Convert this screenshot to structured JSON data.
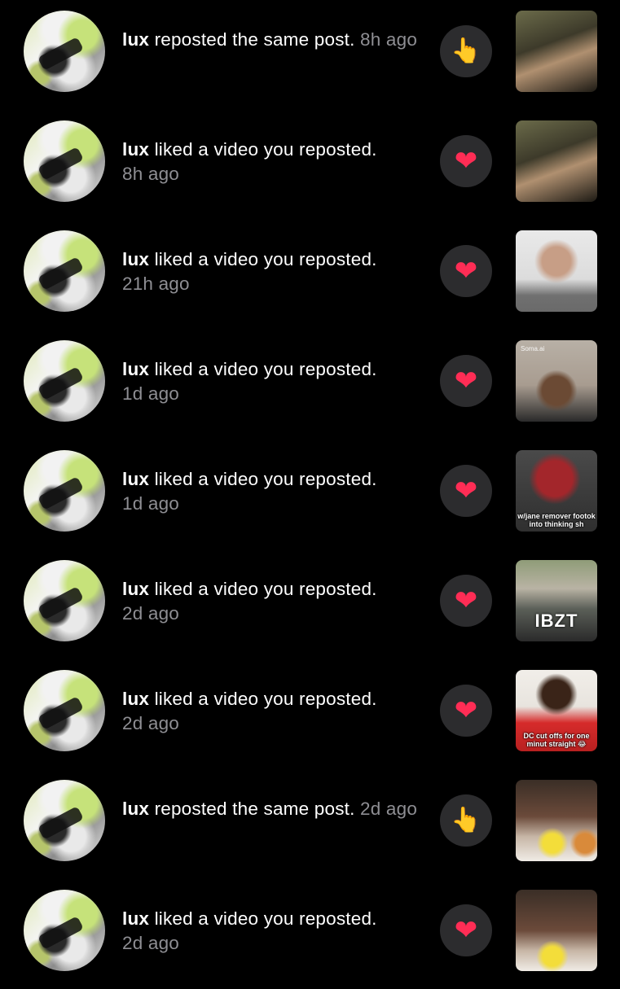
{
  "notifications": [
    {
      "user": "lux",
      "action": "reposted the same post.",
      "time": "8h ago",
      "icon": "hand-icon",
      "thumb": "video-thumbnail"
    },
    {
      "user": "lux",
      "action": "liked a video you reposted.",
      "time": "8h ago",
      "icon": "heart-icon",
      "thumb": "video-thumbnail"
    },
    {
      "user": "lux",
      "action": "liked a video you reposted.",
      "time": "21h ago",
      "icon": "heart-icon",
      "thumb": "video-thumbnail"
    },
    {
      "user": "lux",
      "action": "liked a video you reposted.",
      "time": "1d ago",
      "icon": "heart-icon",
      "thumb": "video-thumbnail",
      "thumb_text": "Soma.ai"
    },
    {
      "user": "lux",
      "action": "liked a video you reposted.",
      "time": "1d ago",
      "icon": "heart-icon",
      "thumb": "video-thumbnail",
      "thumb_text": "w/jane remover footok into thinking sh"
    },
    {
      "user": "lux",
      "action": "liked a video you reposted.",
      "time": "2d ago",
      "icon": "heart-icon",
      "thumb": "video-thumbnail",
      "thumb_text": "IBZT"
    },
    {
      "user": "lux",
      "action": "liked a video you reposted.",
      "time": "2d ago",
      "icon": "heart-icon",
      "thumb": "video-thumbnail",
      "thumb_text": "DC cut offs for one minut straight 😂"
    },
    {
      "user": "lux",
      "action": "reposted the same post.",
      "time": "2d ago",
      "icon": "hand-icon",
      "thumb": "video-thumbnail"
    },
    {
      "user": "lux",
      "action": "liked a video you reposted.",
      "time": "2d ago",
      "icon": "heart-icon",
      "thumb": "video-thumbnail"
    }
  ],
  "glyphs": {
    "heart": "❤",
    "hand": "👆"
  },
  "colors": {
    "background": "#000000",
    "button": "#2c2c2e",
    "heart": "#ff2d55",
    "muted": "#8e8e93"
  }
}
